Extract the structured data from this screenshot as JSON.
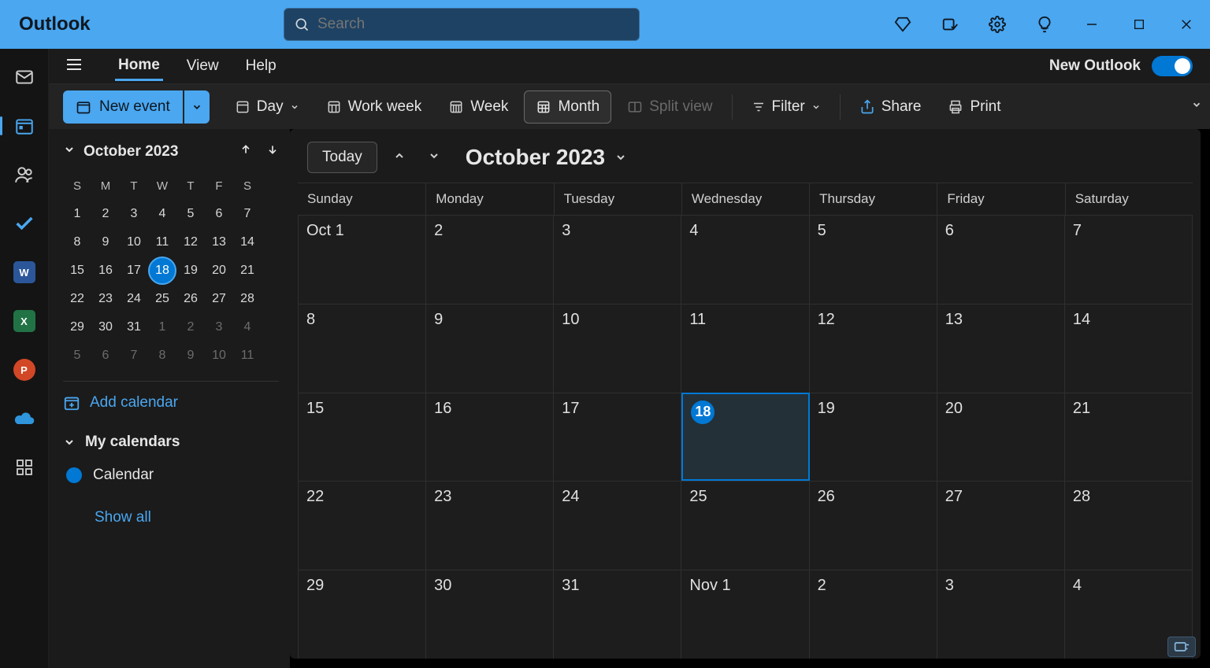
{
  "titlebar": {
    "app_name": "Outlook",
    "search_placeholder": "Search",
    "new_outlook_label": "New Outlook"
  },
  "menubar": {
    "tabs": [
      "Home",
      "View",
      "Help"
    ],
    "active_tab": "Home"
  },
  "toolbar": {
    "new_event": "New event",
    "day": "Day",
    "work_week": "Work week",
    "week": "Week",
    "month": "Month",
    "split_view": "Split view",
    "filter": "Filter",
    "share": "Share",
    "print": "Print"
  },
  "sidepanel": {
    "mini_month_label": "October 2023",
    "weekday_short": [
      "S",
      "M",
      "T",
      "W",
      "T",
      "F",
      "S"
    ],
    "mini_days": [
      [
        "1",
        "2",
        "3",
        "4",
        "5",
        "6",
        "7"
      ],
      [
        "8",
        "9",
        "10",
        "11",
        "12",
        "13",
        "14"
      ],
      [
        "15",
        "16",
        "17",
        "18",
        "19",
        "20",
        "21"
      ],
      [
        "22",
        "23",
        "24",
        "25",
        "26",
        "27",
        "28"
      ],
      [
        "29",
        "30",
        "31",
        "1",
        "2",
        "3",
        "4"
      ],
      [
        "5",
        "6",
        "7",
        "8",
        "9",
        "10",
        "11"
      ]
    ],
    "today_index": {
      "row": 2,
      "col": 3
    },
    "dim_rows_from": 4,
    "dim_row4_from_col": 3,
    "add_calendar": "Add calendar",
    "my_calendars": "My calendars",
    "calendar_item": "Calendar",
    "show_all": "Show all"
  },
  "main": {
    "today_button": "Today",
    "month_title": "October 2023",
    "weekdays": [
      "Sunday",
      "Monday",
      "Tuesday",
      "Wednesday",
      "Thursday",
      "Friday",
      "Saturday"
    ],
    "grid": [
      [
        "Oct 1",
        "2",
        "3",
        "4",
        "5",
        "6",
        "7"
      ],
      [
        "8",
        "9",
        "10",
        "11",
        "12",
        "13",
        "14"
      ],
      [
        "15",
        "16",
        "17",
        "18",
        "19",
        "20",
        "21"
      ],
      [
        "22",
        "23",
        "24",
        "25",
        "26",
        "27",
        "28"
      ],
      [
        "29",
        "30",
        "31",
        "Nov 1",
        "2",
        "3",
        "4"
      ]
    ],
    "today_cell": {
      "row": 2,
      "col": 3,
      "label": "18"
    }
  }
}
